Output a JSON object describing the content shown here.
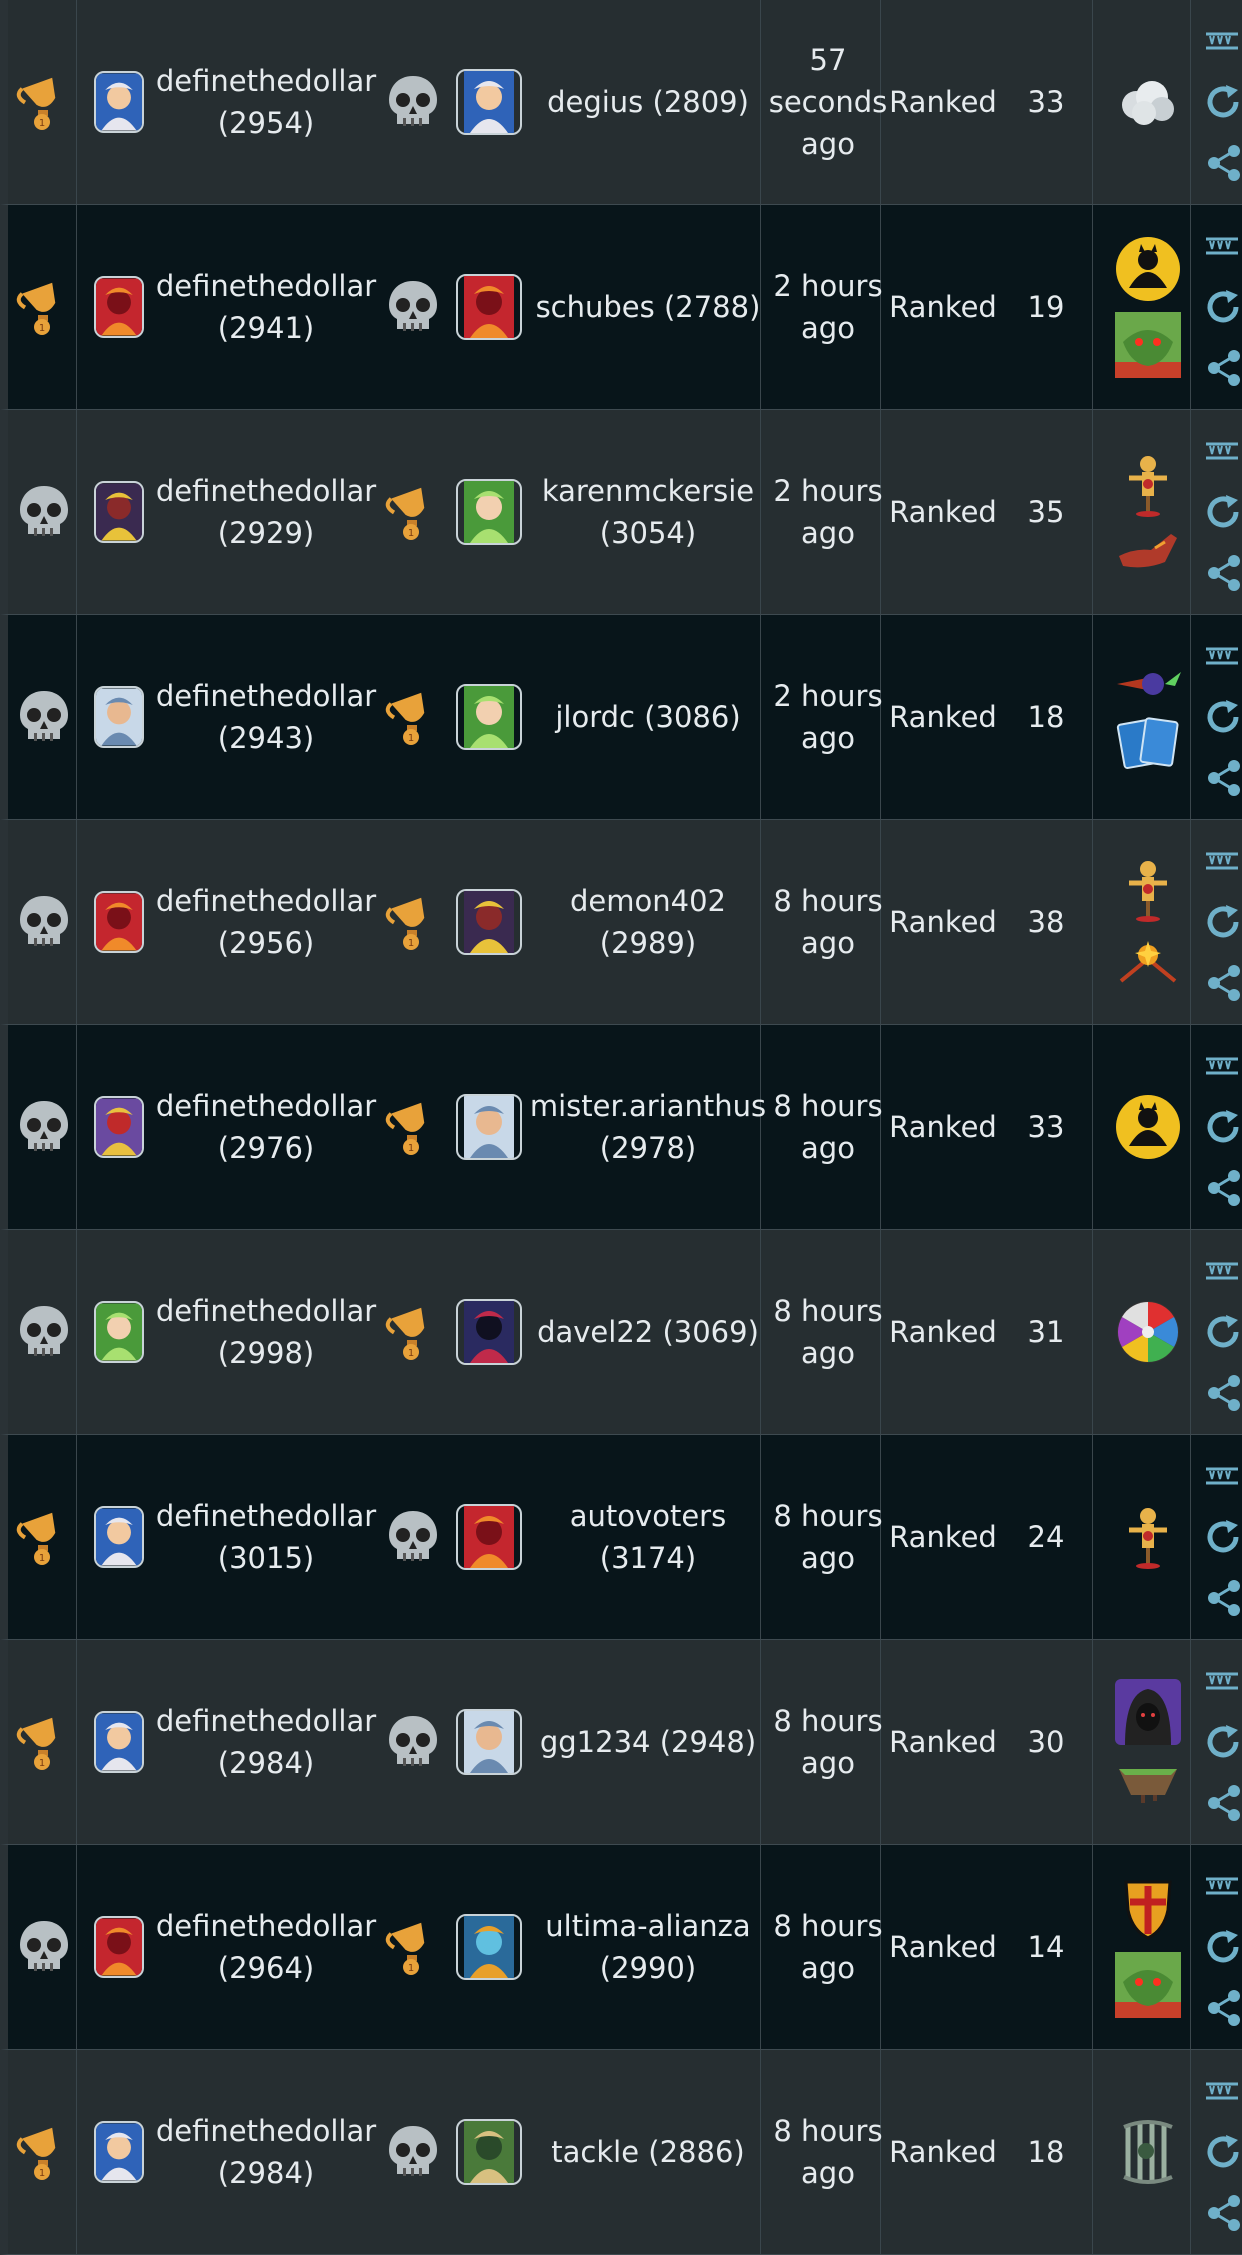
{
  "columns": {
    "mode_label": "Ranked"
  },
  "colors": {
    "win": "#e8a23a",
    "loss": "#b8c0c4",
    "action": "#6fb0c9"
  },
  "rows": [
    {
      "p1_result": "win",
      "p1_avatar": "wizard",
      "p1_name": "definethedollar",
      "p1_rating": "(2954)",
      "p2_result": "loss",
      "p2_avatar": "wizard",
      "p2_name": "degius",
      "p2_rating": "(2809)",
      "p2_inline": true,
      "time_1": "57",
      "time_2": "seconds",
      "time_3": "ago",
      "mode": "Ranked",
      "turns": "33",
      "icons": [
        "cloud"
      ]
    },
    {
      "p1_result": "win",
      "p1_avatar": "dragon",
      "p1_name": "definethedollar",
      "p1_rating": "(2941)",
      "p2_result": "loss",
      "p2_avatar": "dragon",
      "p2_name": "schubes",
      "p2_rating": "(2788)",
      "p2_inline": true,
      "time_1": "2 hours",
      "time_2": "ago",
      "time_3": "",
      "mode": "Ranked",
      "turns": "19",
      "icons": [
        "shadow",
        "goblin"
      ]
    },
    {
      "p1_result": "loss",
      "p1_avatar": "demon",
      "p1_name": "definethedollar",
      "p1_rating": "(2929)",
      "p2_result": "win",
      "p2_avatar": "elf",
      "p2_name": "karenmckersie",
      "p2_rating": "(3054)",
      "p2_inline": false,
      "time_1": "2 hours",
      "time_2": "ago",
      "time_3": "",
      "mode": "Ranked",
      "turns": "35",
      "icons": [
        "dummy",
        "shoe"
      ]
    },
    {
      "p1_result": "loss",
      "p1_avatar": "boy",
      "p1_name": "definethedollar",
      "p1_rating": "(2943)",
      "p2_result": "win",
      "p2_avatar": "elf",
      "p2_name": "jlordc",
      "p2_rating": "(3086)",
      "p2_inline": true,
      "time_1": "2 hours",
      "time_2": "ago",
      "time_3": "",
      "mode": "Ranked",
      "turns": "18",
      "icons": [
        "comet",
        "cards"
      ]
    },
    {
      "p1_result": "loss",
      "p1_avatar": "dragon",
      "p1_name": "definethedollar",
      "p1_rating": "(2956)",
      "p2_result": "win",
      "p2_avatar": "demon",
      "p2_name": "demon402",
      "p2_rating": "(2989)",
      "p2_inline": false,
      "time_1": "8 hours",
      "time_2": "ago",
      "time_3": "",
      "mode": "Ranked",
      "turns": "38",
      "icons": [
        "dummy",
        "arrows"
      ]
    },
    {
      "p1_result": "loss",
      "p1_avatar": "knight",
      "p1_name": "definethedollar",
      "p1_rating": "(2976)",
      "p2_result": "win",
      "p2_avatar": "boy",
      "p2_name": "mister.arianthus",
      "p2_rating": "(2978)",
      "p2_inline": false,
      "time_1": "8 hours",
      "time_2": "ago",
      "time_3": "",
      "mode": "Ranked",
      "turns": "33",
      "icons": [
        "shadow"
      ]
    },
    {
      "p1_result": "loss",
      "p1_avatar": "elf",
      "p1_name": "definethedollar",
      "p1_rating": "(2998)",
      "p2_result": "win",
      "p2_avatar": "dark",
      "p2_name": "davel22",
      "p2_rating": "(3069)",
      "p2_inline": true,
      "time_1": "8 hours",
      "time_2": "ago",
      "time_3": "",
      "mode": "Ranked",
      "turns": "31",
      "icons": [
        "wheel"
      ]
    },
    {
      "p1_result": "win",
      "p1_avatar": "wizard",
      "p1_name": "definethedollar",
      "p1_rating": "(3015)",
      "p2_result": "loss",
      "p2_avatar": "dragon",
      "p2_name": "autovoters",
      "p2_rating": "(3174)",
      "p2_inline": false,
      "time_1": "8 hours",
      "time_2": "ago",
      "time_3": "",
      "mode": "Ranked",
      "turns": "24",
      "icons": [
        "dummy"
      ]
    },
    {
      "p1_result": "win",
      "p1_avatar": "wizard",
      "p1_name": "definethedollar",
      "p1_rating": "(2984)",
      "p2_result": "loss",
      "p2_avatar": "boy",
      "p2_name": "gg1234",
      "p2_rating": "(2948)",
      "p2_inline": true,
      "time_1": "8 hours",
      "time_2": "ago",
      "time_3": "",
      "mode": "Ranked",
      "turns": "30",
      "icons": [
        "hood",
        "island"
      ]
    },
    {
      "p1_result": "loss",
      "p1_avatar": "dragon",
      "p1_name": "definethedollar",
      "p1_rating": "(2964)",
      "p2_result": "win",
      "p2_avatar": "robot",
      "p2_name": "ultima-alianza",
      "p2_rating": "(2990)",
      "p2_inline": false,
      "time_1": "8 hours",
      "time_2": "ago",
      "time_3": "",
      "mode": "Ranked",
      "turns": "14",
      "icons": [
        "shield",
        "goblin"
      ]
    },
    {
      "p1_result": "win",
      "p1_avatar": "wizard",
      "p1_name": "definethedollar",
      "p1_rating": "(2984)",
      "p2_result": "loss",
      "p2_avatar": "ranger",
      "p2_name": "tackle",
      "p2_rating": "(2886)",
      "p2_inline": true,
      "time_1": "8 hours",
      "time_2": "ago",
      "time_3": "",
      "mode": "Ranked",
      "turns": "18",
      "icons": [
        "cage"
      ]
    }
  ]
}
